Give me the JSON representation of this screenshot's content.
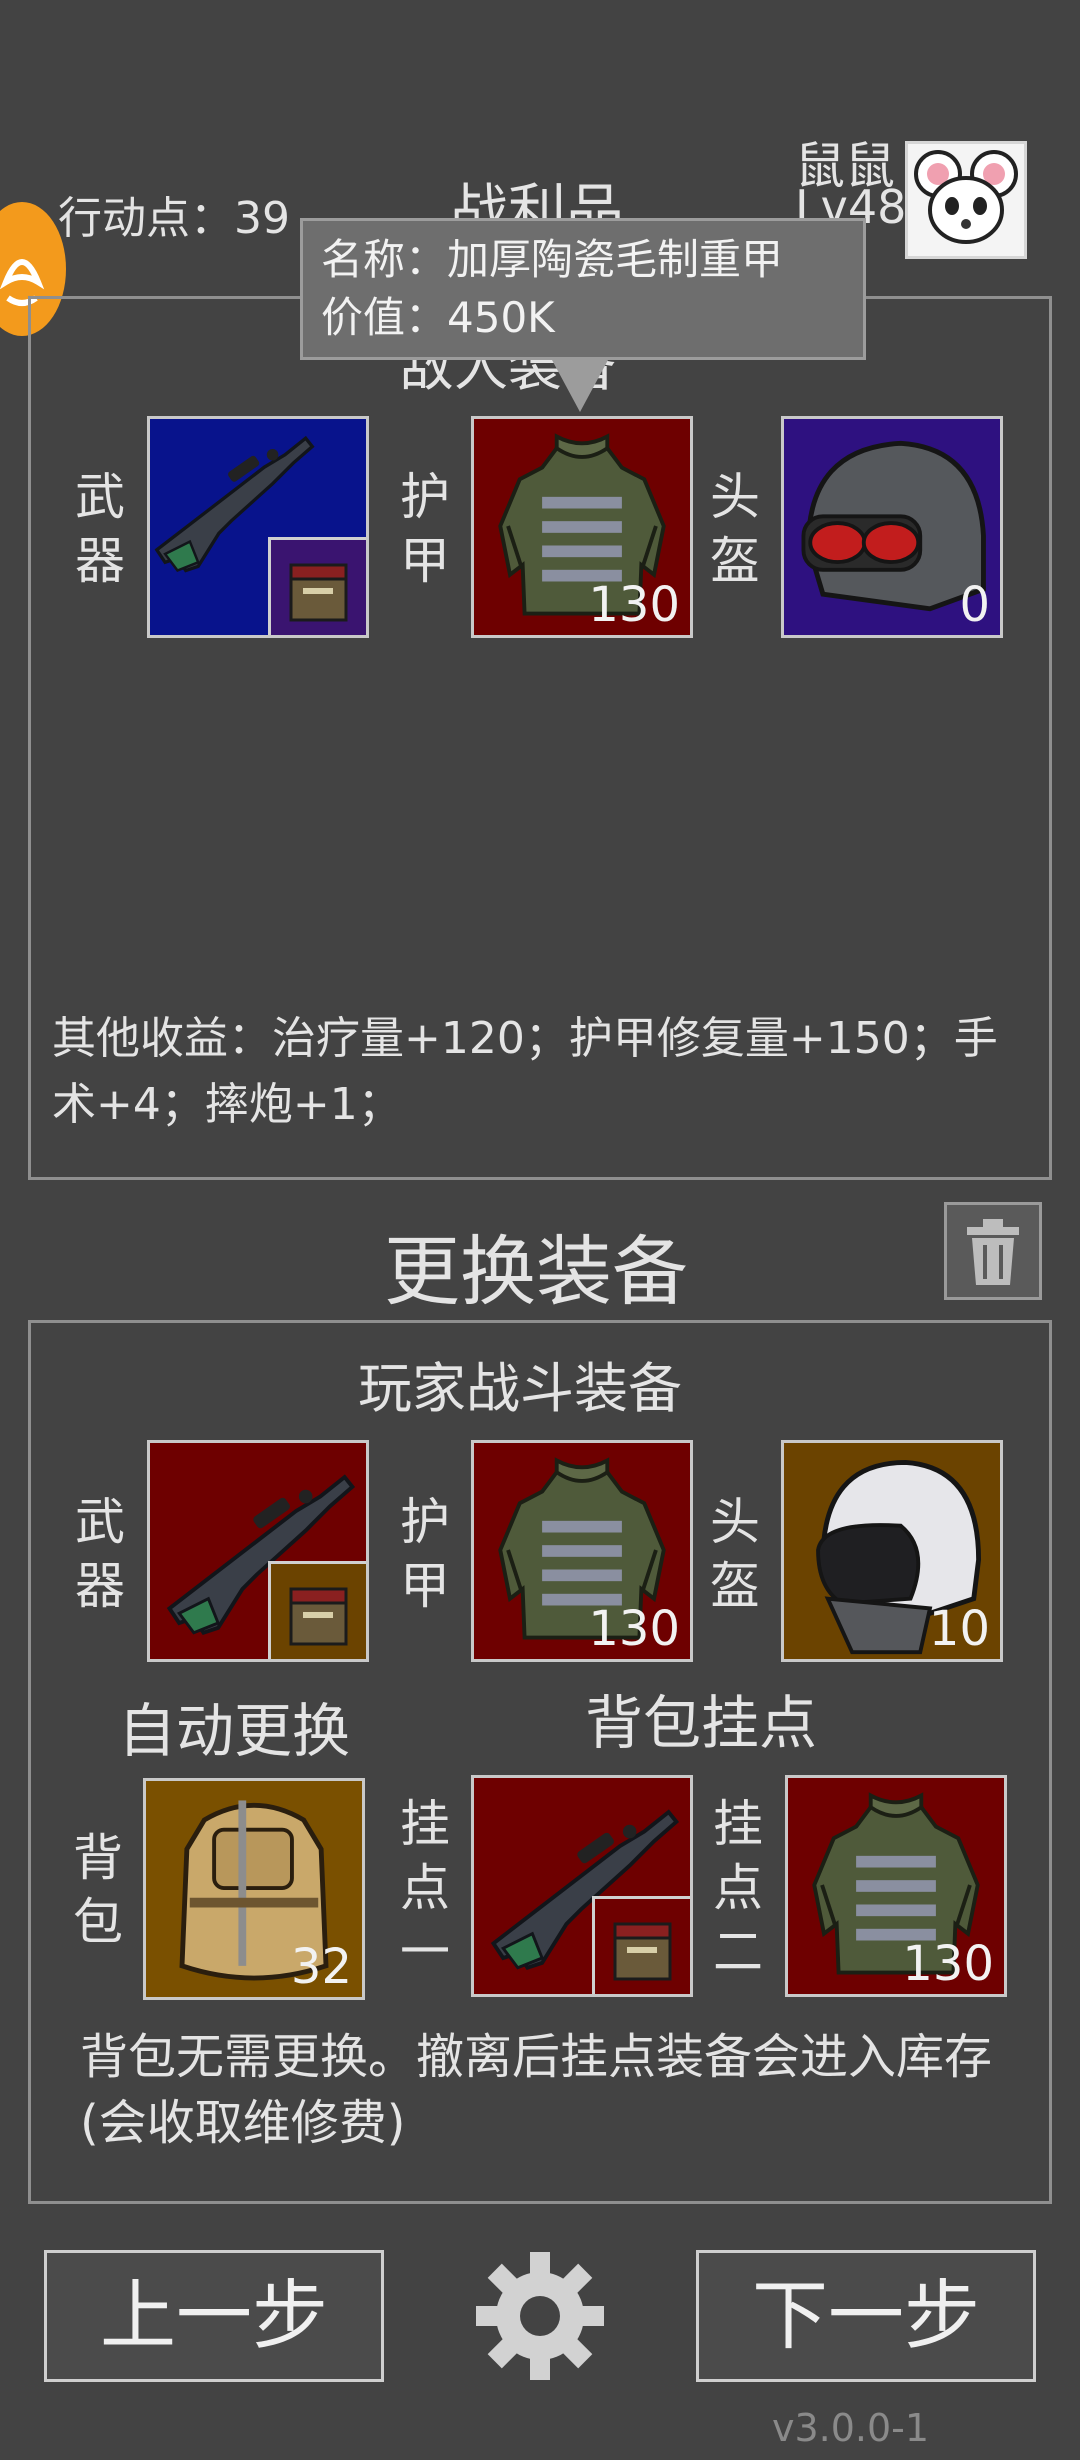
{
  "header": {
    "action_points_label": "行动点：",
    "action_points_value": "39",
    "loot_title": "战利品",
    "player_name": "鼠鼠",
    "player_level": "Lv48",
    "avatar_icon": "white-mouse-avatar",
    "event_icon": "orange-badge-icon"
  },
  "tooltip": {
    "name_label": "名称：",
    "name_value": "加厚陶瓷毛制重甲",
    "value_label": "价值：",
    "value_value": "450K"
  },
  "loot_panel": {
    "section_title": "敌人装备",
    "slots": [
      {
        "label": "武器",
        "item_icon": "assault-rifle-icon",
        "bg": "#08138c",
        "ammo_icon": "ammo-box-icon",
        "count": ""
      },
      {
        "label": "护甲",
        "item_icon": "armor-vest-icon",
        "bg": "#6e0000",
        "count": "130"
      },
      {
        "label": "头盔",
        "item_icon": "tactical-helmet-icon",
        "bg": "#2e1180",
        "count": "0"
      }
    ],
    "other_gains": "其他收益：治疗量+120；护甲修复量+150；手术+4；摔炮+1；"
  },
  "swap_section": {
    "title": "更换装备",
    "trash_icon": "trash-icon"
  },
  "player_panel": {
    "title": "玩家战斗装备",
    "slots": [
      {
        "label": "武器",
        "item_icon": "sniper-rifle-icon",
        "bg": "#6e0000",
        "ammo_icon": "ammo-box-icon",
        "count": ""
      },
      {
        "label": "护甲",
        "item_icon": "armor-vest-icon",
        "bg": "#6e0000",
        "count": "130"
      },
      {
        "label": "头盔",
        "item_icon": "pilot-helmet-icon",
        "bg": "#6b4300",
        "count": "10"
      }
    ],
    "auto_swap_label": "自动更换",
    "attachment_title": "背包挂点",
    "backpack": {
      "label": "背包",
      "item_icon": "backpack-icon",
      "bg": "#7a5000",
      "count": "32"
    },
    "attach_one": {
      "label": "挂点一",
      "item_icon": "sniper-rifle-icon",
      "bg": "#6e0000",
      "count": ""
    },
    "attach_two": {
      "label": "挂点二",
      "item_icon": "armor-vest-icon",
      "bg": "#6e0000",
      "count": "130"
    },
    "note": "背包无需更换。撤离后挂点装备会进入库存(会收取维修费)"
  },
  "footer": {
    "prev_label": "上一步",
    "next_label": "下一步",
    "settings_icon": "gear-icon",
    "version": "v3.0.0-1"
  }
}
